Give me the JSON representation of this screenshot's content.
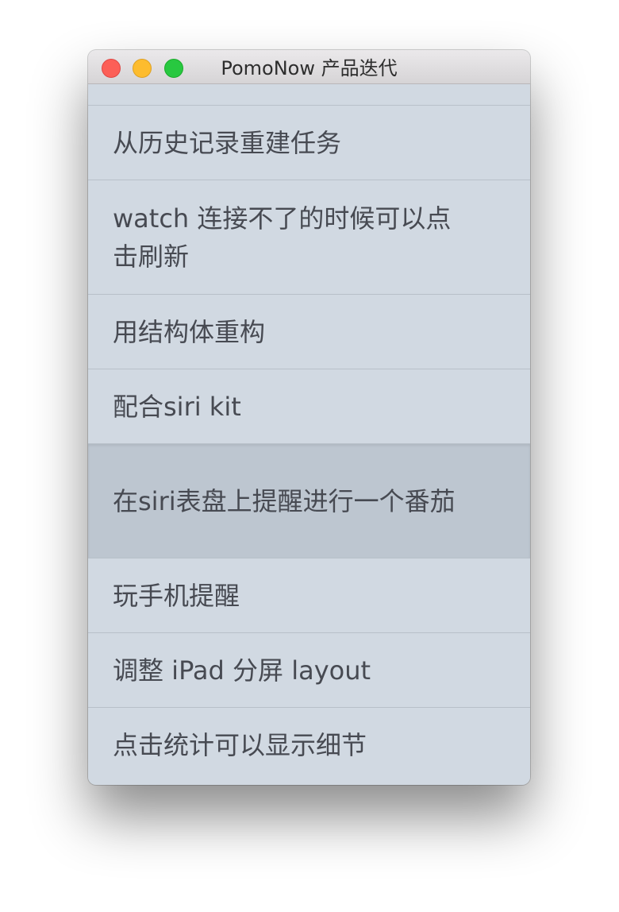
{
  "window": {
    "title": "PomoNow 产品迭代"
  },
  "items": [
    {
      "label": "从历史记录重建任务"
    },
    {
      "label": "watch 连接不了的时候可以点击刷新"
    },
    {
      "label": "用结构体重构"
    },
    {
      "label": "配合siri kit"
    },
    {
      "label": "在siri表盘上提醒进行一个番茄",
      "selected": true
    },
    {
      "label": "玩手机提醒"
    },
    {
      "label": "调整 iPad 分屏 layout"
    },
    {
      "label": "点击统计可以显示细节"
    }
  ],
  "colors": {
    "close": "#fc5f57",
    "minimize": "#fdbc2e",
    "zoom": "#28c840",
    "list_background": "#d1d9e2",
    "selected_row": "#bdc6d0",
    "text": "#474a52"
  }
}
